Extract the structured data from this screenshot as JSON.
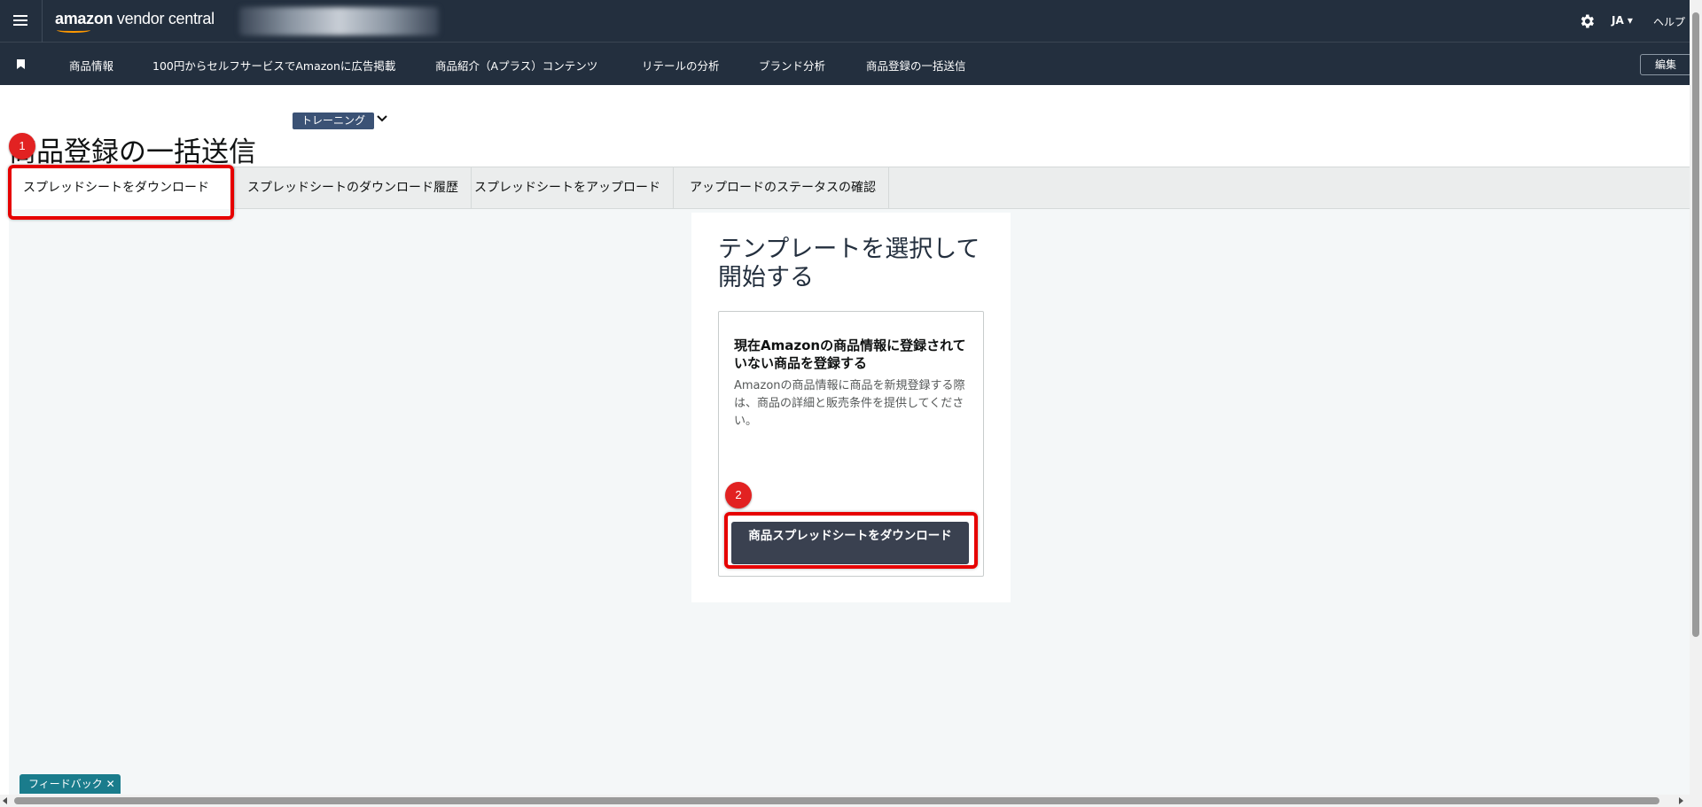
{
  "header": {
    "logo_brand": "amazon",
    "logo_suffix": " vendor central",
    "lang": "JA ▾",
    "help": "ヘルプ"
  },
  "nav": {
    "items": [
      "商品情報",
      "100円からセルフサービスでAmazonに広告掲載",
      "商品紹介（Aプラス）コンテンツ",
      "リテールの分析",
      "ブランド分析",
      "商品登録の一括送信"
    ],
    "edit": "編集"
  },
  "page": {
    "badge": "トレーニング",
    "title": "商品登録の一括送信"
  },
  "tabs": [
    "スプレッドシートをダウンロード",
    "スプレッドシートのダウンロード履歴",
    "スプレッドシートをアップロード",
    "アップロードのステータスの確認"
  ],
  "panel": {
    "heading": "テンプレートを選択して開始する",
    "card_title": "現在Amazonの商品情報に登録されていない商品を登録する",
    "card_desc": "Amazonの商品情報に商品を新規登録する際は、商品の詳細と販売条件を提供してください。",
    "button": "商品スプレッドシートをダウンロード"
  },
  "annotations": {
    "step1": "1",
    "step2": "2"
  },
  "feedback": {
    "label": "フィードバック",
    "close": "✕"
  },
  "colors": {
    "header_bg": "#232f3e",
    "accent": "#ff9900",
    "highlight": "#e60000",
    "feedback": "#1a7c8c"
  }
}
